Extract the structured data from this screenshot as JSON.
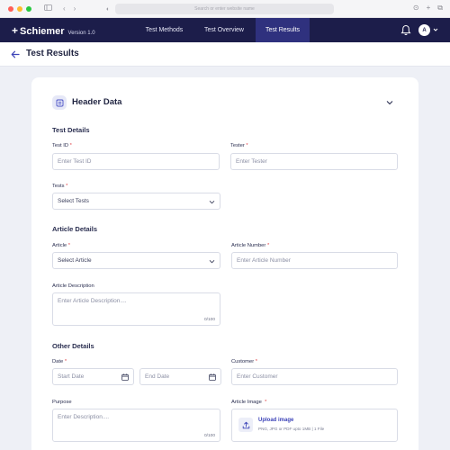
{
  "browser": {
    "url_placeholder": "Search or enter website name",
    "traffic_lights": [
      "#ff5f57",
      "#febc2e",
      "#28c840"
    ]
  },
  "navbar": {
    "brand_name": "Schiemer",
    "brand_version": "Version 1.0",
    "tabs": [
      {
        "label": "Test Methods",
        "active": false
      },
      {
        "label": "Test Overview",
        "active": false
      },
      {
        "label": "Test Results",
        "active": true
      }
    ],
    "avatar_initial": "A",
    "colors": {
      "bar": "#1c1d4a",
      "active_tab": "#2f317e"
    }
  },
  "page": {
    "title": "Test Results"
  },
  "card": {
    "title": "Header Data",
    "sections": {
      "test_details": "Test Details",
      "article_details": "Article Details",
      "other_details": "Other Details"
    },
    "fields": {
      "test_id": {
        "label": "Test ID",
        "required": "*",
        "placeholder": "Enter Test ID"
      },
      "tester": {
        "label": "Tester",
        "required": "*",
        "placeholder": "Enter Tester"
      },
      "tests": {
        "label": "Tests",
        "required": "*",
        "value": "Select Tests"
      },
      "article": {
        "label": "Article",
        "required": "*",
        "value": "Select Article"
      },
      "article_number": {
        "label": "Article Number",
        "required": "*",
        "placeholder": "Enter Article Number"
      },
      "article_description": {
        "label": "Article Description",
        "placeholder": "Enter Article Description....",
        "counter": "0/100"
      },
      "date": {
        "label": "Date",
        "required": "*",
        "start_placeholder": "Start Date",
        "end_placeholder": "End Date"
      },
      "customer": {
        "label": "Customer",
        "required": "*",
        "placeholder": "Enter Customer"
      },
      "purpose": {
        "label": "Purpose",
        "placeholder": "Enter Description....",
        "counter": "0/100"
      },
      "article_image": {
        "label": "Article Image",
        "required": "*",
        "upload_title": "Upload image",
        "upload_hint": "PNG, JPG or PDF upto 1MB | 1 File"
      }
    }
  },
  "icons": {
    "back": "arrow-left-icon",
    "bell": "bell-icon",
    "collapse": "chevron-down-icon",
    "calendar": "calendar-icon",
    "upload": "upload-icon",
    "header_data": "document-icon"
  }
}
